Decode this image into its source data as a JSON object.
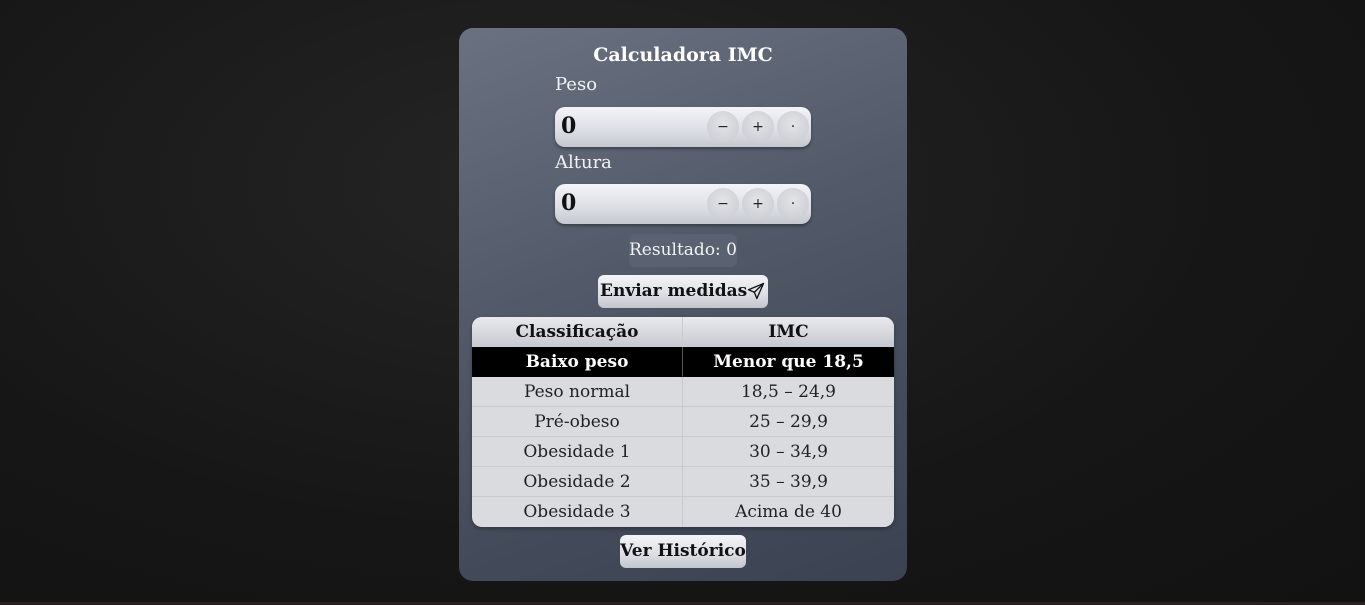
{
  "app": {
    "title": "Calculadora IMC"
  },
  "weight": {
    "label": "Peso",
    "value": "0",
    "decrement": "−",
    "increment": "+",
    "decimal": "·"
  },
  "height": {
    "label": "Altura",
    "value": "0",
    "decrement": "−",
    "increment": "+",
    "decimal": "·"
  },
  "result": {
    "text": "Resultado: 0"
  },
  "actions": {
    "send_label": "Enviar medidas",
    "history_label": "Ver Histórico"
  },
  "table": {
    "headers": [
      "Classificação",
      "IMC"
    ],
    "rows": [
      {
        "classification": "Baixo peso",
        "imc": "Menor que 18,5",
        "highlighted": true
      },
      {
        "classification": "Peso normal",
        "imc": "18,5 – 24,9"
      },
      {
        "classification": "Pré-obeso",
        "imc": "25 – 29,9"
      },
      {
        "classification": "Obesidade 1",
        "imc": "30 – 34,9"
      },
      {
        "classification": "Obesidade 2",
        "imc": "35 – 39,9"
      },
      {
        "classification": "Obesidade 3",
        "imc": "Acima de 40"
      }
    ]
  },
  "icons": {
    "send": "paper-plane-icon"
  }
}
